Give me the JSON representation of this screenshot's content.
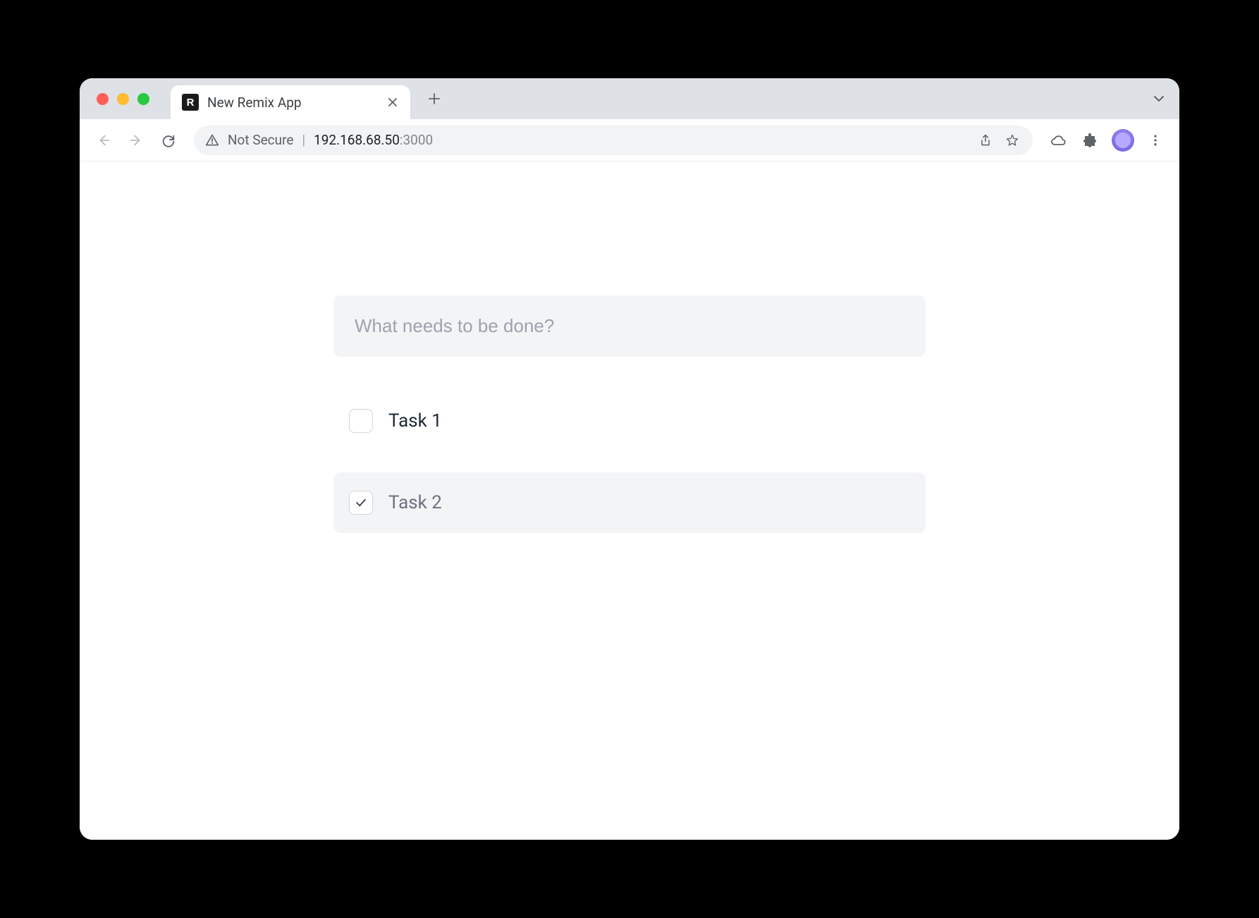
{
  "browser": {
    "tab": {
      "title": "New Remix App"
    },
    "omnibox": {
      "not_secure_label": "Not Secure",
      "host": "192.168.68.50",
      "port": ":3000"
    }
  },
  "app": {
    "new_task_placeholder": "What needs to be done?",
    "tasks": [
      {
        "label": "Task 1",
        "done": false
      },
      {
        "label": "Task 2",
        "done": true
      }
    ]
  }
}
